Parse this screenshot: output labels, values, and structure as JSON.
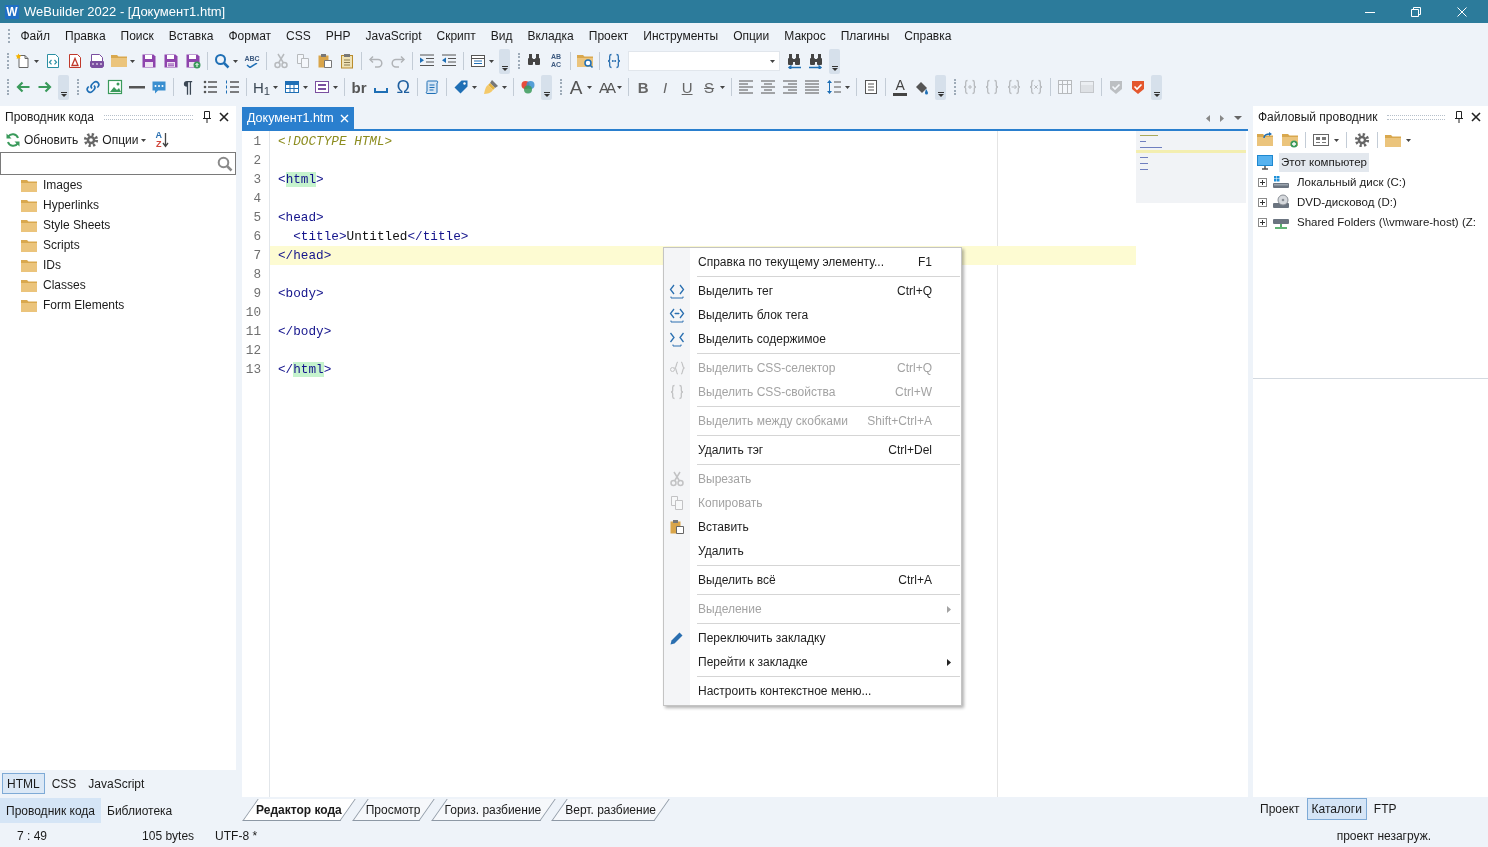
{
  "title_bar": {
    "app_icon_glyph": "W",
    "title": "WeBuilder 2022 - [Документ1.htm]"
  },
  "menu_bar": [
    "Файл",
    "Правка",
    "Поиск",
    "Вставка",
    "Формат",
    "CSS",
    "PHP",
    "JavaScript",
    "Скрипт",
    "Вид",
    "Вкладка",
    "Проект",
    "Инструменты",
    "Опции",
    "Макрос",
    "Плагины",
    "Справка"
  ],
  "toolbar_rows": [
    {
      "bands": [
        {
          "items": [
            {
              "kind": "button",
              "disabled": false,
              "dropdown": true
            },
            {
              "kind": "button",
              "disabled": false,
              "dropdown": false
            },
            {
              "kind": "button",
              "disabled": false,
              "dropdown": false
            },
            {
              "kind": "button",
              "disabled": false,
              "dropdown": false
            },
            {
              "kind": "button",
              "disabled": false,
              "dropdown": true
            },
            {
              "kind": "button",
              "disabled": false,
              "dropdown": false
            },
            {
              "kind": "button",
              "disabled": false,
              "dropdown": false
            },
            {
              "kind": "button",
              "disabled": false,
              "dropdown": false
            },
            {
              "kind": "separator"
            },
            {
              "kind": "button",
              "disabled": false,
              "dropdown": true
            },
            {
              "kind": "glyph",
              "lines": [
                "ABC"
              ],
              "disabled": false,
              "dropdown": false
            },
            {
              "kind": "separator"
            },
            {
              "kind": "button",
              "disabled": true,
              "dropdown": false
            },
            {
              "kind": "button",
              "disabled": true,
              "dropdown": false
            },
            {
              "kind": "button",
              "disabled": false,
              "dropdown": false
            },
            {
              "kind": "button",
              "disabled": false,
              "dropdown": false
            },
            {
              "kind": "separator"
            },
            {
              "kind": "button",
              "disabled": true,
              "dropdown": false
            },
            {
              "kind": "button",
              "disabled": true,
              "dropdown": false
            },
            {
              "kind": "separator"
            },
            {
              "kind": "button",
              "disabled": false,
              "dropdown": false
            },
            {
              "kind": "button",
              "disabled": false,
              "dropdown": false
            },
            {
              "kind": "separator"
            },
            {
              "kind": "button",
              "disabled": false,
              "dropdown": true
            }
          ]
        },
        {
          "items": [
            {
              "kind": "button",
              "disabled": false,
              "dropdown": false
            },
            {
              "kind": "glyph",
              "lines": [
                "AB",
                "AC"
              ],
              "disabled": false,
              "dropdown": false
            },
            {
              "kind": "separator"
            },
            {
              "kind": "button",
              "disabled": false,
              "dropdown": false
            },
            {
              "kind": "separator"
            },
            {
              "kind": "button",
              "disabled": false,
              "dropdown": false
            },
            {
              "kind": "combo"
            },
            {
              "kind": "button",
              "disabled": false,
              "dropdown": false
            },
            {
              "kind": "button",
              "disabled": false,
              "dropdown": false
            }
          ]
        }
      ]
    },
    {
      "bands": [
        {
          "items": [
            {
              "kind": "button",
              "disabled": false,
              "dropdown": false
            },
            {
              "kind": "button",
              "disabled": false,
              "dropdown": false
            }
          ]
        },
        {
          "items": [
            {
              "kind": "button",
              "disabled": false,
              "dropdown": false
            },
            {
              "kind": "button",
              "disabled": false,
              "dropdown": false
            },
            {
              "kind": "button",
              "disabled": false,
              "dropdown": false
            },
            {
              "kind": "button",
              "disabled": false,
              "dropdown": false
            },
            {
              "kind": "separator"
            },
            {
              "kind": "glyph",
              "lines": [
                "¶"
              ],
              "disabled": false,
              "dropdown": false
            },
            {
              "kind": "button",
              "disabled": false,
              "dropdown": false
            },
            {
              "kind": "button",
              "disabled": false,
              "dropdown": false
            },
            {
              "kind": "separator"
            },
            {
              "kind": "glyph",
              "lines": [
                "H$_{1}$"
              ],
              "disabled": false,
              "dropdown": true
            },
            {
              "kind": "button",
              "disabled": false,
              "dropdown": true
            },
            {
              "kind": "button",
              "disabled": false,
              "dropdown": true
            },
            {
              "kind": "separator"
            },
            {
              "kind": "glyph",
              "lines": [
                "br"
              ],
              "disabled": false,
              "dropdown": false
            },
            {
              "kind": "button",
              "disabled": false,
              "dropdown": false
            },
            {
              "kind": "glyph",
              "lines": [
                "Ω"
              ],
              "disabled": false,
              "dropdown": false
            },
            {
              "kind": "separator"
            },
            {
              "kind": "button",
              "disabled": false,
              "dropdown": false
            },
            {
              "kind": "separator"
            },
            {
              "kind": "button",
              "disabled": false,
              "dropdown": true
            },
            {
              "kind": "button",
              "disabled": false,
              "dropdown": true
            },
            {
              "kind": "separator"
            },
            {
              "kind": "button",
              "disabled": false,
              "dropdown": false
            }
          ]
        },
        {
          "items": [
            {
              "kind": "glyph",
              "lines": [
                "A"
              ],
              "disabled": false,
              "dropdown": true
            },
            {
              "kind": "glyph",
              "lines": [
                "AA"
              ],
              "disabled": false,
              "dropdown": true
            },
            {
              "kind": "separator"
            },
            {
              "kind": "glyph",
              "lines": [
                "B"
              ],
              "disabled": false,
              "dropdown": false
            },
            {
              "kind": "glyph",
              "lines": [
                "I"
              ],
              "disabled": false,
              "dropdown": false
            },
            {
              "kind": "glyph",
              "lines": [
                "U"
              ],
              "disabled": false,
              "dropdown": false
            },
            {
              "kind": "glyph",
              "lines": [
                "S"
              ],
              "disabled": false,
              "dropdown": true
            },
            {
              "kind": "separator"
            },
            {
              "kind": "button",
              "disabled": false,
              "dropdown": false
            },
            {
              "kind": "button",
              "disabled": false,
              "dropdown": false
            },
            {
              "kind": "button",
              "disabled": false,
              "dropdown": false
            },
            {
              "kind": "button",
              "disabled": false,
              "dropdown": false
            },
            {
              "kind": "button",
              "disabled": false,
              "dropdown": true
            },
            {
              "kind": "separator"
            },
            {
              "kind": "button",
              "disabled": false,
              "dropdown": false
            },
            {
              "kind": "separator"
            },
            {
              "kind": "glyph",
              "lines": [
                "A"
              ],
              "disabled": false,
              "dropdown": false
            },
            {
              "kind": "button",
              "disabled": false,
              "dropdown": false
            }
          ]
        },
        {
          "items": [
            {
              "kind": "button",
              "disabled": true,
              "dropdown": false
            },
            {
              "kind": "button",
              "disabled": true,
              "dropdown": false
            },
            {
              "kind": "button",
              "disabled": true,
              "dropdown": false
            },
            {
              "kind": "button",
              "disabled": true,
              "dropdown": false
            },
            {
              "kind": "separator"
            },
            {
              "kind": "button",
              "disabled": true,
              "dropdown": false
            },
            {
              "kind": "button",
              "disabled": true,
              "dropdown": false
            },
            {
              "kind": "separator"
            },
            {
              "kind": "button",
              "disabled": true,
              "dropdown": false
            },
            {
              "kind": "button",
              "disabled": false,
              "dropdown": false
            }
          ]
        }
      ]
    }
  ],
  "code_explorer": {
    "title": "Проводник кода",
    "actions": [
      {
        "label": "Обновить",
        "dropdown": false
      },
      {
        "label": "Опции",
        "dropdown": true
      }
    ],
    "sort_letters": [
      "A",
      "Z"
    ],
    "tree": [
      "Images",
      "Hyperlinks",
      "Style Sheets",
      "Scripts",
      "IDs",
      "Classes",
      "Form Elements"
    ],
    "language_tabs": [
      {
        "label": "HTML",
        "selected": true
      },
      {
        "label": "CSS",
        "selected": false
      },
      {
        "label": "JavaScript",
        "selected": false
      }
    ],
    "panel_tabs": [
      {
        "label": "Проводник кода",
        "selected": true
      },
      {
        "label": "Библиотека",
        "selected": false
      }
    ]
  },
  "editor": {
    "tabs": [
      {
        "label": "Документ1.htm",
        "selected": true
      }
    ],
    "lines": [
      {
        "number": "1",
        "current": false,
        "tokens": [
          {
            "kind": "doctype",
            "text": "<!DOCTYPE HTML>",
            "matched": false
          }
        ]
      },
      {
        "number": "2",
        "current": false
      },
      {
        "number": "3",
        "current": false,
        "tokens": [
          {
            "kind": "tag",
            "text": "<",
            "matched": false
          },
          {
            "kind": "tag",
            "text": "html",
            "matched": true
          },
          {
            "kind": "tag",
            "text": ">",
            "matched": false
          }
        ]
      },
      {
        "number": "4",
        "current": false
      },
      {
        "number": "5",
        "current": false,
        "tokens": [
          {
            "kind": "tag",
            "text": "<head>",
            "matched": false
          }
        ]
      },
      {
        "number": "6",
        "current": false,
        "tokens": [
          {
            "kind": "tag",
            "text": "  <title>",
            "matched": false
          },
          {
            "kind": "text",
            "text": "Untitled",
            "matched": false
          },
          {
            "kind": "tag",
            "text": "</title>",
            "matched": false
          }
        ]
      },
      {
        "number": "7",
        "current": true,
        "tokens": [
          {
            "kind": "tag",
            "text": "</head>",
            "matched": false
          }
        ]
      },
      {
        "number": "8",
        "current": false
      },
      {
        "number": "9",
        "current": false,
        "tokens": [
          {
            "kind": "tag",
            "text": "<body>",
            "matched": false
          }
        ]
      },
      {
        "number": "10",
        "current": false
      },
      {
        "number": "11",
        "current": false,
        "tokens": [
          {
            "kind": "tag",
            "text": "</body>",
            "matched": false
          }
        ]
      },
      {
        "number": "12",
        "current": false
      },
      {
        "number": "13",
        "current": false,
        "tokens": [
          {
            "kind": "tag",
            "text": "</",
            "matched": false
          },
          {
            "kind": "tag",
            "text": "html",
            "matched": true
          },
          {
            "kind": "tag",
            "text": ">",
            "matched": false
          }
        ]
      }
    ],
    "view_tabs": [
      {
        "label": "Редактор кода",
        "selected": true
      },
      {
        "label": "Просмотр",
        "selected": false
      },
      {
        "label": "Гориз. разбиение",
        "selected": false
      },
      {
        "label": "Верт. разбиение",
        "selected": false
      }
    ]
  },
  "file_explorer": {
    "title": "Файловый проводник",
    "tree": [
      {
        "kind": "computer",
        "label": "Этот компьютер",
        "selected": true,
        "children": [
          {
            "kind": "disk",
            "label": "Локальный диск (C:)",
            "selected": false,
            "expanded": false
          },
          {
            "kind": "dvd",
            "label": "DVD-дисковод (D:)",
            "selected": false,
            "expanded": false
          },
          {
            "kind": "network",
            "label": "Shared Folders (\\\\vmware-host) (Z:",
            "selected": false,
            "expanded": false
          }
        ]
      }
    ],
    "tabs": [
      {
        "label": "Проект",
        "selected": false
      },
      {
        "label": "Каталоги",
        "selected": true
      },
      {
        "label": "FTP",
        "selected": false
      }
    ]
  },
  "status_bar": {
    "position": "7 : 49",
    "size": "105 bytes",
    "encoding": "UTF-8 *",
    "project": "проект незагруж."
  },
  "context_menu": {
    "groups": [
      {
        "items": [
          {
            "label": "Справка по текущему элементу...",
            "shortcut": "F1",
            "disabled": false,
            "submenu": false
          }
        ]
      },
      {
        "items": [
          {
            "label": "Выделить тег",
            "shortcut": "Ctrl+Q",
            "disabled": false,
            "submenu": false
          },
          {
            "label": "Выделить блок тега",
            "disabled": false,
            "submenu": false
          },
          {
            "label": "Выделить содержимое",
            "disabled": false,
            "submenu": false
          }
        ]
      },
      {
        "items": [
          {
            "label": "Выделить CSS-селектор",
            "shortcut": "Ctrl+Q",
            "disabled": true,
            "submenu": false
          },
          {
            "label": "Выделить CSS-свойства",
            "shortcut": "Ctrl+W",
            "disabled": true,
            "submenu": false
          }
        ]
      },
      {
        "items": [
          {
            "label": "Выделить между скобками",
            "shortcut": "Shift+Ctrl+A",
            "disabled": true,
            "submenu": false
          }
        ]
      },
      {
        "items": [
          {
            "label": "Удалить тэг",
            "shortcut": "Ctrl+Del",
            "disabled": false,
            "submenu": false
          }
        ]
      },
      {
        "items": [
          {
            "label": "Вырезать",
            "disabled": true,
            "submenu": false
          },
          {
            "label": "Копировать",
            "disabled": true,
            "submenu": false
          },
          {
            "label": "Вставить",
            "disabled": false,
            "submenu": false
          },
          {
            "label": "Удалить",
            "disabled": false,
            "submenu": false
          }
        ]
      },
      {
        "items": [
          {
            "label": "Выделить всё",
            "shortcut": "Ctrl+A",
            "disabled": false,
            "submenu": false
          }
        ]
      },
      {
        "items": [
          {
            "label": "Выделение",
            "disabled": true,
            "submenu": true
          }
        ]
      },
      {
        "items": [
          {
            "label": "Переключить закладку",
            "disabled": false,
            "submenu": false
          },
          {
            "label": "Перейти к закладке",
            "disabled": false,
            "submenu": true
          }
        ]
      },
      {
        "items": [
          {
            "label": "Настроить контекстное меню...",
            "disabled": false,
            "submenu": false
          }
        ]
      }
    ]
  }
}
